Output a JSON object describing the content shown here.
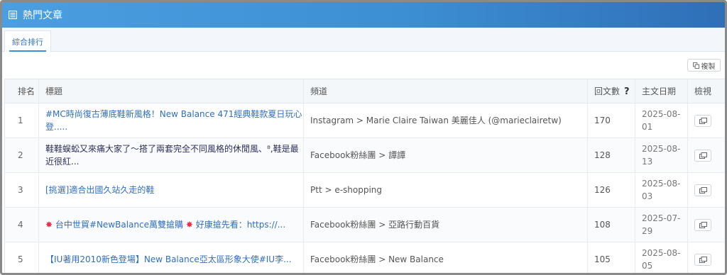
{
  "header": {
    "title": "熱門文章",
    "icon": "document-list-icon"
  },
  "tabs": [
    {
      "label": "綜合排行",
      "active": true
    }
  ],
  "toolbar": {
    "copy_label": "複製",
    "copy_icon": "copy-icon"
  },
  "table": {
    "columns": {
      "rank": "排名",
      "title": "標題",
      "channel": "頻道",
      "replies": "回文數",
      "replies_help": "?",
      "date": "主文日期",
      "view": "檢視"
    },
    "rows": [
      {
        "rank": "1",
        "title": "#MC時尚復古薄底鞋新風格！New Balance 471經典鞋款夏日玩心登.....",
        "channel": "Instagram > Marie Claire Taiwan 美麗佳人 (@marieclairetw)",
        "replies": "170",
        "date_line1": "2025-08-",
        "date_line2": "01"
      },
      {
        "rank": "2",
        "title": "鞋鞋蜈蚣又來痛大家了～搭了兩套完全不同風格的休閒風、⁸,鞋是最近很紅...",
        "channel": "Facebook粉絲團 > 譚譚",
        "replies": "128",
        "date_line1": "2025-08-",
        "date_line2": "13"
      },
      {
        "rank": "3",
        "title": "[挑選]適合出國久站久走的鞋",
        "channel": "Ptt > e-shopping",
        "replies": "126",
        "date_line1": "2025-08-",
        "date_line2": "03"
      },
      {
        "rank": "4",
        "title": "台中世貿#NewBalance萬雙搶購",
        "title_mid": "好康搶先看：https://...",
        "channel": "Facebook粉絲團 > 亞路行動百貨",
        "replies": "108",
        "date_line1": "2025-07-",
        "date_line2": "29"
      },
      {
        "rank": "5",
        "title": "【IU著用2010新色登場】New Balance亞太區形象大使#IU李...",
        "channel": "Facebook粉絲團 > New Balance",
        "replies": "105",
        "date_line1": "2025-08-",
        "date_line2": "05"
      }
    ]
  },
  "colors": {
    "header_start": "#4b9fe0",
    "header_end": "#2f6fb8",
    "link": "#2f6fc0",
    "burst": "#e0344c"
  }
}
